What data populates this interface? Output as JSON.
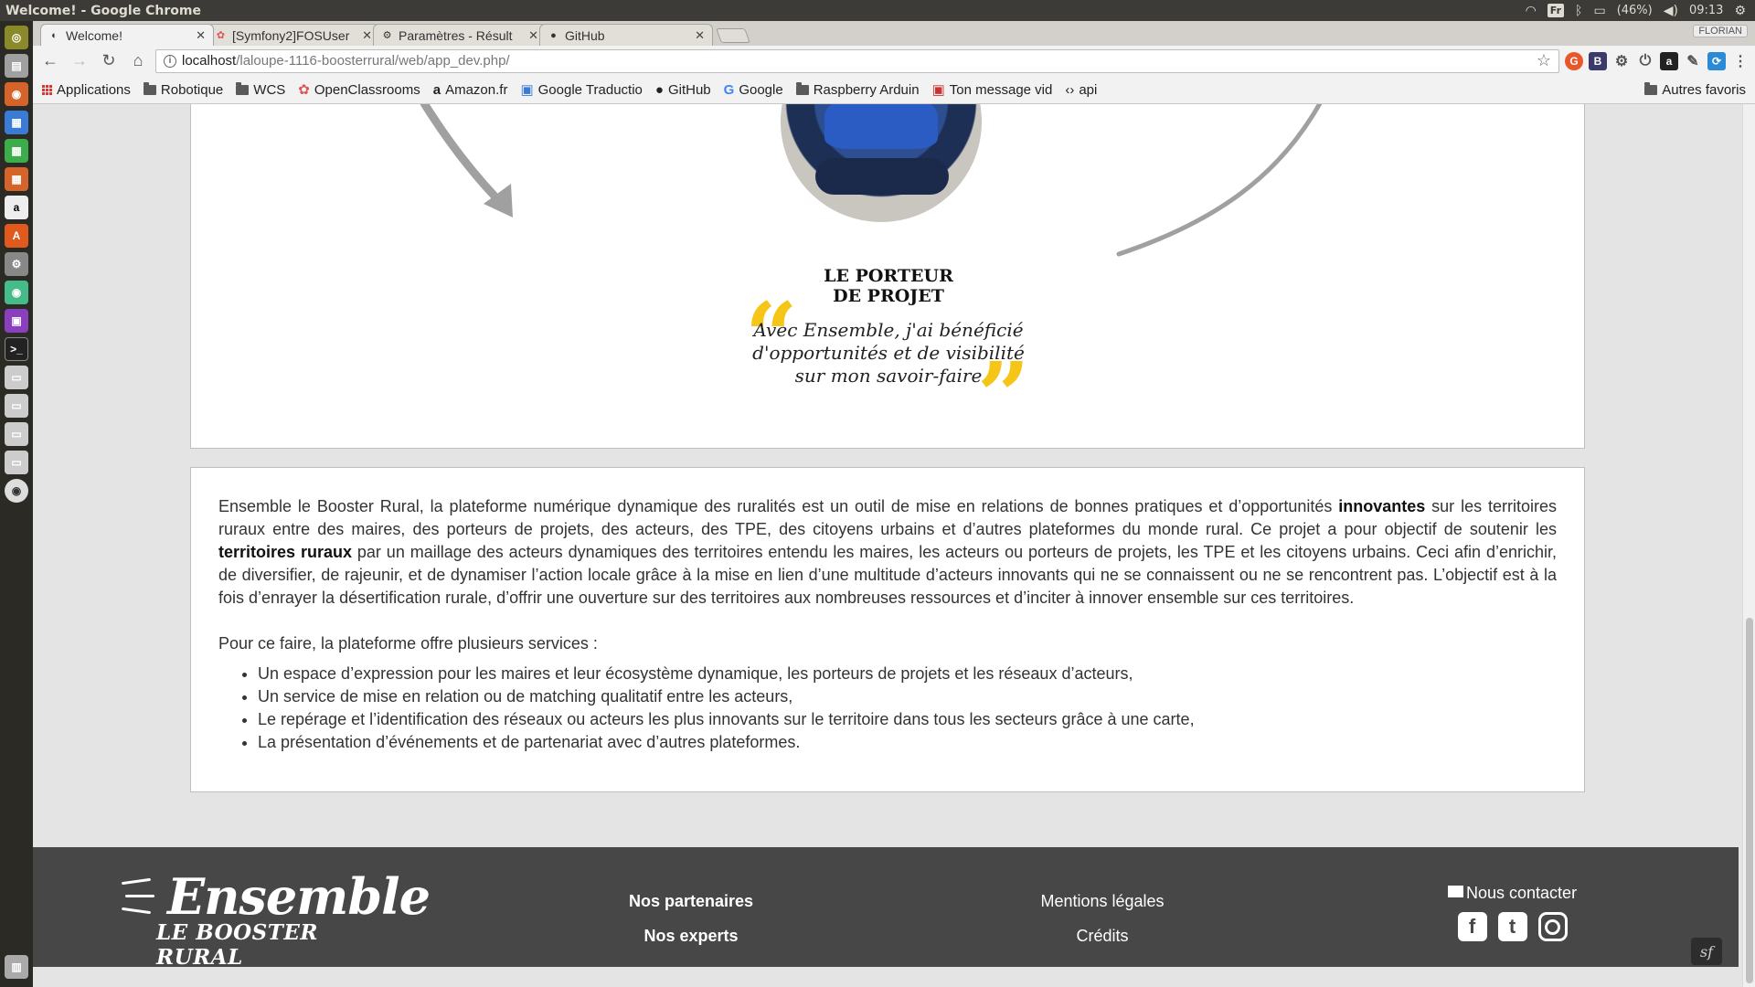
{
  "os": {
    "window_title": "Welcome! - Google Chrome",
    "lang": "Fr",
    "battery": "(46%)",
    "clock": "09:13"
  },
  "browser": {
    "tabs": [
      {
        "label": "Welcome!",
        "active": true
      },
      {
        "label": "[Symfony2]FOSUser",
        "active": false
      },
      {
        "label": "Paramètres - Résult",
        "active": false
      },
      {
        "label": "GitHub",
        "active": false
      }
    ],
    "profile": "FLORIAN",
    "url_host": "localhost",
    "url_path": "/laloupe-1116-boosterrural/web/app_dev.php/",
    "bookmarks": [
      "Applications",
      "Robotique",
      "WCS",
      "OpenClassrooms",
      "Amazon.fr",
      "Google Traductio",
      "GitHub",
      "Google",
      "Raspberry Arduin",
      "Ton message vid",
      "api"
    ],
    "other_bookmarks": "Autres favoris"
  },
  "testimonial": {
    "title_line1": "LE PORTEUR",
    "title_line2": "DE PROJET",
    "quote_line1": "Avec Ensemble, j'ai bénéficié",
    "quote_line2": "d'opportunités et de visibilité",
    "quote_line3": "sur mon savoir-faire"
  },
  "description": {
    "p1_a": "Ensemble le Booster Rural, la plateforme numérique dynamique des ruralités est un outil de mise en relations de bonnes pratiques et d’opportunités ",
    "p1_b": "innovantes",
    "p1_c": " sur les territoires ruraux entre des maires, des porteurs de projets, des acteurs, des TPE, des citoyens urbains et d’autres plateformes du monde rural. Ce projet a pour objectif de soutenir les ",
    "p1_d": "territoires ruraux",
    "p1_e": " par un maillage des acteurs dynamiques des territoires entendu les maires, les acteurs ou porteurs de projets, les TPE et les citoyens urbains. Ceci afin d’enrichir, de diversifier, de rajeunir, et de dynamiser l’action locale grâce à la mise en lien d’une multitude d’acteurs innovants qui ne se connaissent ou ne se rencontrent pas. L’objectif est à la fois d’enrayer la désertification rurale, d’offrir une ouverture sur des territoires aux nombreuses ressources et d’inciter à innover ensemble sur ces territoires.",
    "intro": "Pour ce faire, la plateforme offre plusieurs services :",
    "services": [
      "Un espace d’expression pour les maires et leur écosystème dynamique, les porteurs de projets et les réseaux d’acteurs,",
      "Un service de mise en relation ou de matching qualitatif entre les acteurs,",
      "Le repérage et l’identification des réseaux ou acteurs les plus innovants sur le territoire dans tous les secteurs grâce à une carte,",
      "La présentation d’événements et de partenariat avec d’autres plateformes."
    ]
  },
  "footer": {
    "logo_main": "Ensemble",
    "logo_sub": "LE BOOSTER RURAL",
    "partners": "Nos partenaires",
    "experts": "Nos experts",
    "legal": "Mentions légales",
    "credits": "Crédits",
    "contact": "Nous contacter"
  },
  "colors": {
    "accent_quote": "#f5c518",
    "footer_bg": "#474747"
  }
}
